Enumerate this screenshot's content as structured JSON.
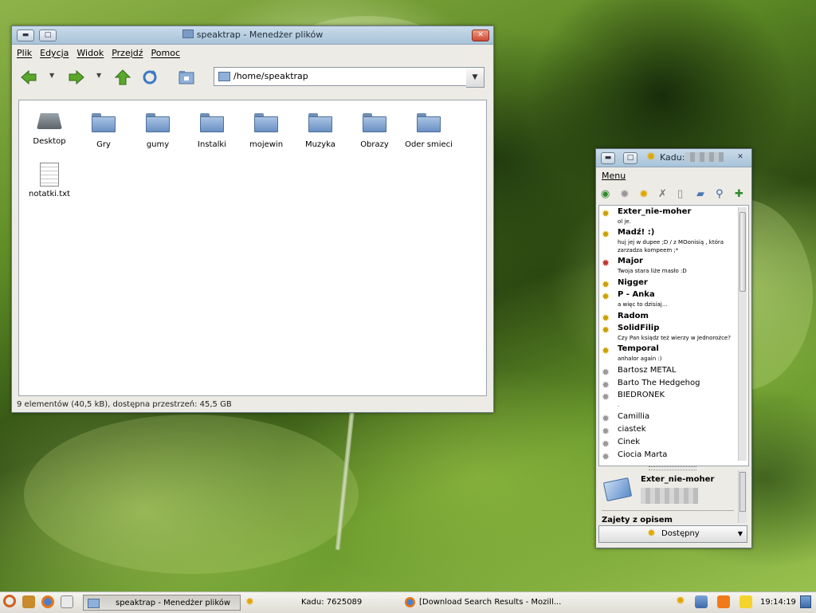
{
  "file_manager": {
    "title": "speaktrap - Menedżer plików",
    "menu": [
      "Plik",
      "Edycja",
      "Widok",
      "Przejdź",
      "Pomoc"
    ],
    "toolbar_icons": [
      "back-arrow-icon",
      "forward-arrow-icon",
      "up-arrow-icon",
      "reload-icon",
      "home-folder-icon"
    ],
    "location": "/home/speaktrap",
    "items": [
      {
        "label": "Desktop",
        "icon": "desktop-drive-icon"
      },
      {
        "label": "Gry",
        "icon": "folder-icon"
      },
      {
        "label": "gumy",
        "icon": "folder-icon"
      },
      {
        "label": "Instalki",
        "icon": "folder-icon"
      },
      {
        "label": "mojewin",
        "icon": "folder-icon"
      },
      {
        "label": "Muzyka",
        "icon": "folder-icon"
      },
      {
        "label": "Obrazy",
        "icon": "folder-icon"
      },
      {
        "label": "Oder smieci",
        "icon": "folder-icon"
      },
      {
        "label": "notatki.txt",
        "icon": "text-file-icon"
      }
    ],
    "status": "9 elementów (40,5 kB), dostępna przestrzeń: 45,5 GB"
  },
  "kadu": {
    "title": "Kadu:",
    "menu": "Menu",
    "contacts": [
      {
        "name": "Exter_nie-moher",
        "desc": "ol je.",
        "bold": true
      },
      {
        "name": "Madź! :)",
        "desc": "huj jej w dupee ;D / z MOonisią , która zarzadza kompeem ;*",
        "bold": true
      },
      {
        "name": "Major",
        "desc": "Twoja stara liże masło :D",
        "bold": true
      },
      {
        "name": "Nigger",
        "desc": "",
        "bold": true
      },
      {
        "name": "P - Anka",
        "desc": "a więc to dzisiaj...",
        "bold": true
      },
      {
        "name": "Radom",
        "desc": "",
        "bold": true
      },
      {
        "name": "SolidFilip",
        "desc": "Czy Pan ksiądz też wierzy w Jednorożce?",
        "bold": true
      },
      {
        "name": "Temporal",
        "desc": "anhalor again :)",
        "bold": true
      },
      {
        "name": "Bartosz METAL",
        "desc": "",
        "bold": false
      },
      {
        "name": "Barto The Hedgehog",
        "desc": "",
        "bold": false
      },
      {
        "name": "BIEDRONEK",
        "desc": ".",
        "bold": false
      },
      {
        "name": "Camillia",
        "desc": "",
        "bold": false
      },
      {
        "name": "ciastek",
        "desc": "",
        "bold": false
      },
      {
        "name": "Cinek",
        "desc": "",
        "bold": false
      },
      {
        "name": "Ciocia Marta",
        "desc": "",
        "bold": false
      }
    ],
    "info_name": "Exter_nie-moher",
    "info_status": "Zajety z opisem",
    "status_select": "Dostępny"
  },
  "taskbar": {
    "tasks": [
      "speaktrap - Menedżer plików",
      "Kadu: 7625089",
      "[Download Search Results - Mozill..."
    ],
    "clock": "19:14:19"
  }
}
